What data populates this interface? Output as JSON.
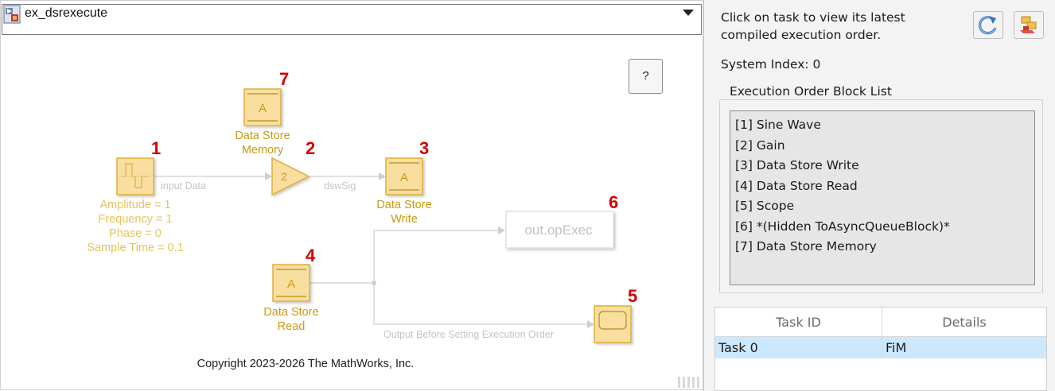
{
  "model_bar": {
    "name": "ex_dsrexecute"
  },
  "canvas": {
    "help_label": "?",
    "copyright": "Copyright 2023-2026 The MathWorks, Inc.",
    "blocks": {
      "sine_wave": {
        "order": "1",
        "params": [
          "Amplitude = 1",
          "Frequency = 1",
          "Phase = 0",
          "Sample Time = 0.1"
        ]
      },
      "gain": {
        "order": "2",
        "glyph": "2"
      },
      "ds_write": {
        "order": "3",
        "glyph": "A",
        "label": [
          "Data Store",
          "Write"
        ]
      },
      "ds_read": {
        "order": "4",
        "glyph": "A",
        "label": [
          "Data Store",
          "Read"
        ]
      },
      "scope": {
        "order": "5"
      },
      "out_opexec": {
        "order": "6",
        "text": "out.opExec"
      },
      "ds_memory": {
        "order": "7",
        "glyph": "A",
        "label": [
          "Data Store",
          "Memory"
        ]
      }
    },
    "signals": {
      "input_data": "input Data",
      "dswsig": "dswSig",
      "output_before": "Output Before Setting Execution Order"
    }
  },
  "panel": {
    "instruction": "Click on task to view its latest compiled execution order.",
    "system_index": "System Index: 0",
    "group_title": "Execution Order Block List",
    "block_list": [
      "[1]  Sine Wave",
      "[2]  Gain",
      "[3]  Data Store Write",
      "[4]  Data Store Read",
      "[5]  Scope",
      "[6]  *(Hidden ToAsyncQueueBlock)*",
      "[7]  Data Store Memory"
    ],
    "table": {
      "headers": [
        "Task ID",
        "Details"
      ],
      "rows": [
        {
          "task_id": "Task 0",
          "details": "FiM"
        }
      ]
    }
  },
  "colors": {
    "block_fill": "#f8dfa0",
    "block_border": "#e0ae3a",
    "order_number": "#d40000",
    "selected_row": "#cce8ff",
    "signal_line": "#cfcfcf"
  }
}
